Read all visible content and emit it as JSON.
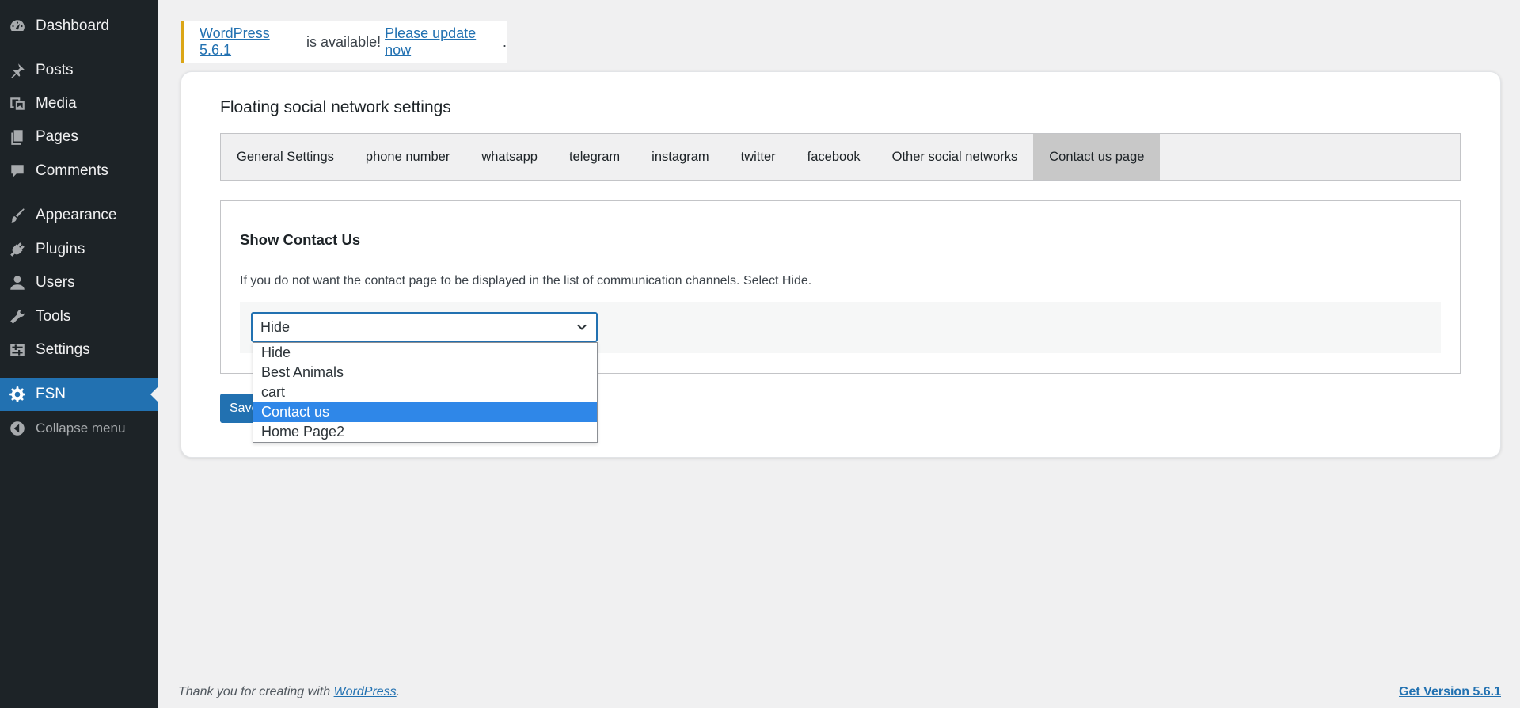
{
  "sidebar": {
    "items": [
      {
        "label": "Dashboard",
        "icon": "dashboard-icon"
      },
      {
        "label": "Posts",
        "icon": "pin-icon"
      },
      {
        "label": "Media",
        "icon": "media-icon"
      },
      {
        "label": "Pages",
        "icon": "pages-icon"
      },
      {
        "label": "Comments",
        "icon": "comment-icon"
      },
      {
        "label": "Appearance",
        "icon": "brush-icon"
      },
      {
        "label": "Plugins",
        "icon": "plug-icon"
      },
      {
        "label": "Users",
        "icon": "user-icon"
      },
      {
        "label": "Tools",
        "icon": "wrench-icon"
      },
      {
        "label": "Settings",
        "icon": "settings-sliders-icon"
      },
      {
        "label": "FSN",
        "icon": "gear-icon",
        "active": true
      },
      {
        "label": "Collapse menu",
        "icon": "collapse-arrow-icon"
      }
    ]
  },
  "notice": {
    "link_version": "WordPress 5.6.1",
    "middle_text": " is available! ",
    "link_update": "Please update now",
    "end_text": "."
  },
  "main": {
    "title": "Floating social network settings",
    "tabs": [
      "General Settings",
      "phone number",
      "whatsapp",
      "telegram",
      "instagram",
      "twitter",
      "facebook",
      "Other social networks",
      "Contact us page"
    ],
    "active_tab": "Contact us page",
    "section": {
      "title": "Show Contact Us",
      "description": "If you do not want the contact page to be displayed in the list of communication channels. Select Hide.",
      "select_value": "Hide",
      "options": [
        "Hide",
        "Best Animals",
        "cart",
        "Contact us",
        "Home Page2"
      ],
      "highlighted_option": "Contact us"
    },
    "save_label": "Save"
  },
  "footer": {
    "thanks_prefix": "Thank you for creating with ",
    "thanks_link": "WordPress",
    "thanks_suffix": ".",
    "version_link": "Get Version 5.6.1"
  },
  "colors": {
    "sidebar_bg": "#1d2327",
    "accent": "#2271b1",
    "notice_border": "#dba617",
    "highlight_option": "#2f87e8"
  }
}
